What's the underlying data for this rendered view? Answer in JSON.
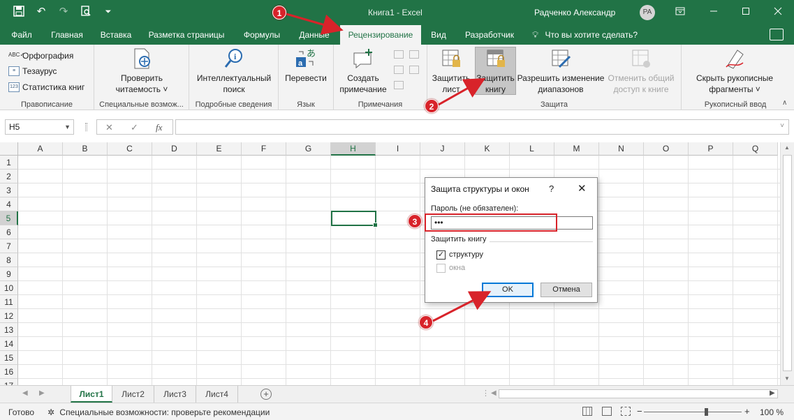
{
  "titlebar": {
    "doc_title": "Книга1  -  Excel",
    "user_name": "Радченко Александр",
    "user_initials": "РА",
    "qat_icons": [
      "save-icon",
      "undo-icon",
      "redo-icon",
      "print-preview-icon",
      "customize-qat-icon"
    ],
    "window_icons": [
      "ribbon-display-options-icon",
      "minimize-icon",
      "maximize-icon",
      "close-icon"
    ]
  },
  "tabs": {
    "items": [
      "Файл",
      "Главная",
      "Вставка",
      "Разметка страницы",
      "Формулы",
      "Данные",
      "Рецензирование",
      "Вид",
      "Разработчик"
    ],
    "active": "Рецензирование",
    "tell_me": "Что вы хотите сделать?"
  },
  "ribbon": {
    "proofing": {
      "label": "Правописание",
      "items": [
        {
          "label": "Орфография",
          "icon": "spelling-icon"
        },
        {
          "label": "Тезаурус",
          "icon": "thesaurus-icon"
        },
        {
          "label": "Статистика книг",
          "icon": "workbook-stats-icon"
        }
      ]
    },
    "accessibility": {
      "label": "Специальные возмож...",
      "button_line1": "Проверить",
      "button_line2": "читаемость ˅"
    },
    "insights": {
      "label": "Подробные сведения",
      "button_line1": "Интеллектуальный",
      "button_line2": "поиск"
    },
    "language": {
      "label": "Язык",
      "button": "Перевести"
    },
    "comments": {
      "label": "Примечания",
      "button_line1": "Создать",
      "button_line2": "примечание"
    },
    "protect": {
      "label": "Защита",
      "protect_sheet_line1": "Защитить",
      "protect_sheet_line2": "лист",
      "protect_workbook_line1": "Защитить",
      "protect_workbook_line2": "книгу",
      "allow_edit_line1": "Разрешить изменение",
      "allow_edit_line2": "диапазонов",
      "unshare_line1": "Отменить общий",
      "unshare_line2": "доступ к книге"
    },
    "ink": {
      "label": "Рукописный ввод",
      "button_line1": "Скрыть рукописные",
      "button_line2": "фрагменты ˅"
    }
  },
  "formula_bar": {
    "name_box": "H5",
    "cancel_glyph": "✕",
    "enter_glyph": "✓",
    "fx_label": "fx",
    "formula": ""
  },
  "grid": {
    "columns": [
      "A",
      "B",
      "C",
      "D",
      "E",
      "F",
      "G",
      "H",
      "I",
      "J",
      "K",
      "L",
      "M",
      "N",
      "O",
      "P",
      "Q"
    ],
    "rows": [
      "1",
      "2",
      "3",
      "4",
      "5",
      "6",
      "7",
      "8",
      "9",
      "10",
      "11",
      "12",
      "13",
      "14",
      "15",
      "16",
      "17"
    ],
    "selected_cell": "H5"
  },
  "sheets": {
    "tabs": [
      "Лист1",
      "Лист2",
      "Лист3",
      "Лист4"
    ],
    "active": "Лист1",
    "add_glyph": "+"
  },
  "status": {
    "ready": "Готово",
    "accessibility": "Специальные возможности: проверьте рекомендации",
    "zoom": "100 %",
    "zoom_minus": "−",
    "zoom_plus": "+"
  },
  "dialog": {
    "title": "Защита структуры и окон",
    "help": "?",
    "close": "✕",
    "password_label": "Пароль (не обязателен):",
    "password_value": "•••",
    "group_label": "Защитить книгу",
    "structure_label": "структуру",
    "structure_checked": true,
    "windows_label": "окна",
    "windows_checked": false,
    "ok": "OK",
    "cancel": "Отмена"
  },
  "annotations": {
    "badges": [
      "1",
      "2",
      "3",
      "4"
    ],
    "color": "#d8232a"
  },
  "colors": {
    "excel_green": "#217346",
    "ribbon_bg": "#f3f3f3",
    "accent_blue": "#0078d7"
  }
}
